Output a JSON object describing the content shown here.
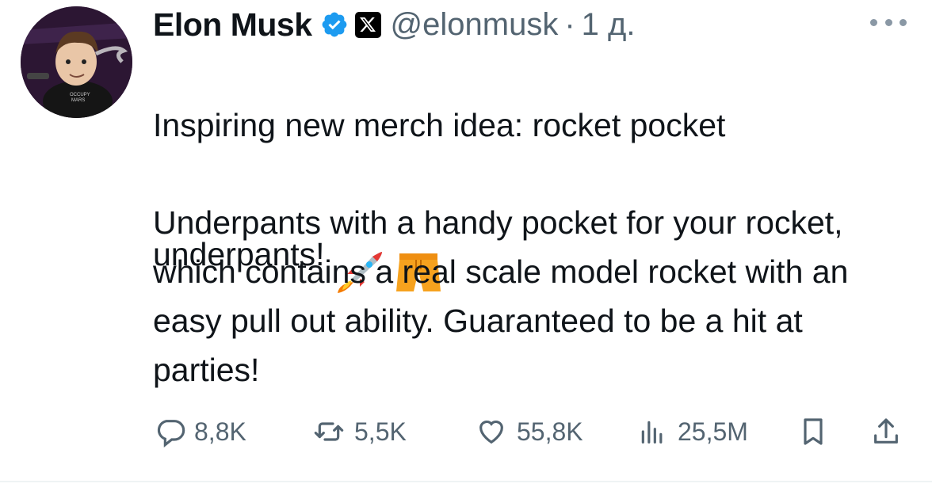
{
  "tweet": {
    "name": "Elon Musk",
    "handle": "@elonmusk",
    "separator": "·",
    "time": "1 д.",
    "text_line1": "Inspiring new merch idea: rocket pocket",
    "text_line2": "underpants!",
    "emojis": [
      "rocket-emoji",
      "shorts-emoji"
    ],
    "text_para2": "Underpants with a handy pocket for your rocket, which contains a real scale model rocket with an easy pull out ability. Guaranteed to be a hit at parties!"
  },
  "stats": {
    "replies": "8,8K",
    "reposts": "5,5K",
    "likes": "55,8K",
    "views": "25,5M"
  },
  "colors": {
    "text": "#0f1419",
    "secondary": "#536471",
    "verified": "#1d9bf0"
  }
}
